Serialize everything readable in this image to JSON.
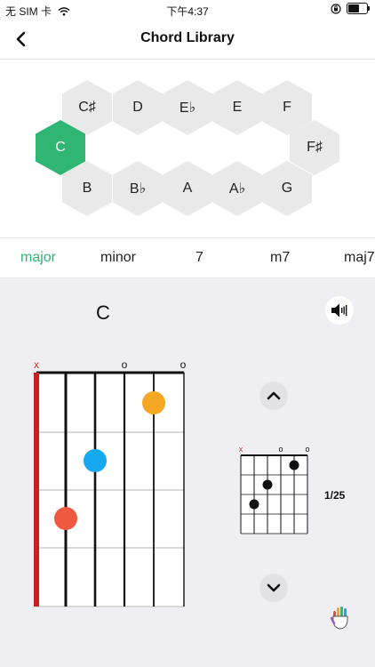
{
  "status_bar": {
    "carrier": "无 SIM 卡",
    "time": "下午4:37",
    "battery_level": 0.6
  },
  "nav": {
    "title": "Chord Library"
  },
  "keys": {
    "top": [
      "C♯",
      "D",
      "E♭",
      "E",
      "F"
    ],
    "left": "C",
    "right": "F♯",
    "bottom": [
      "B",
      "B♭",
      "A",
      "A♭",
      "G"
    ],
    "selected": "C"
  },
  "chord_types": [
    "major",
    "minor",
    "7",
    "m7",
    "maj7"
  ],
  "selected_type": "major",
  "chord": {
    "name": "C",
    "string_markers": [
      "x",
      "",
      "",
      "",
      "o",
      "o"
    ],
    "dot_colors": [
      "#f5a623",
      "#17a9f0",
      "#f05a40"
    ]
  },
  "pager": {
    "text": "1/25"
  },
  "accent_color": "#2fb673"
}
